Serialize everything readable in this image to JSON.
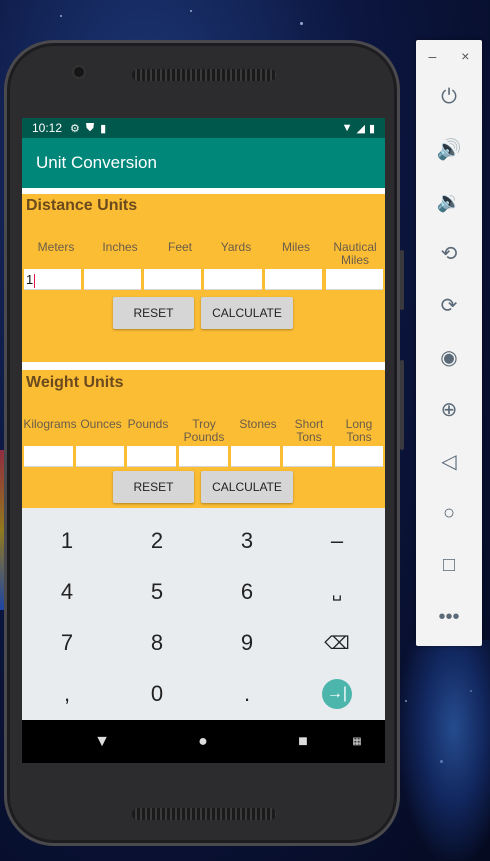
{
  "status_bar": {
    "time": "10:12",
    "icons": [
      "settings-icon",
      "shield-icon",
      "sd-card-icon"
    ],
    "right_icons": [
      "wifi-icon",
      "signal-icon",
      "battery-icon"
    ]
  },
  "app_bar": {
    "title": "Unit Conversion"
  },
  "distance": {
    "title": "Distance Units",
    "columns": [
      "Meters",
      "Inches",
      "Feet",
      "Yards",
      "Miles",
      "Nautical Miles"
    ],
    "values": [
      "1",
      "",
      "",
      "",
      "",
      ""
    ],
    "reset_label": "RESET",
    "calculate_label": "CALCULATE"
  },
  "weight": {
    "title": "Weight Units",
    "columns": [
      "Kilograms",
      "Ounces",
      "Pounds",
      "Troy Pounds",
      "Stones",
      "Short Tons",
      "Long Tons"
    ],
    "values": [
      "",
      "",
      "",
      "",
      "",
      "",
      ""
    ],
    "reset_label": "RESET",
    "calculate_label": "CALCULATE"
  },
  "keyboard": {
    "rows": [
      [
        "1",
        "2",
        "3",
        "–"
      ],
      [
        "4",
        "5",
        "6",
        "␣"
      ],
      [
        "7",
        "8",
        "9",
        "⌫"
      ],
      [
        ",",
        "0",
        ".",
        "→|"
      ]
    ]
  },
  "emulator_panel": {
    "window_controls": [
      "–",
      "×"
    ],
    "buttons": [
      "power-icon",
      "volume-up-icon",
      "volume-down-icon",
      "rotate-left-icon",
      "rotate-right-icon",
      "camera-icon",
      "zoom-icon",
      "back-icon",
      "home-icon",
      "overview-icon",
      "more-icon"
    ]
  },
  "colors": {
    "status_bar": "#00574b",
    "app_bar": "#00877a",
    "section_bg": "#fbbd33",
    "keyboard_bg": "#e9ecef",
    "enter_key": "#4db6ac"
  }
}
